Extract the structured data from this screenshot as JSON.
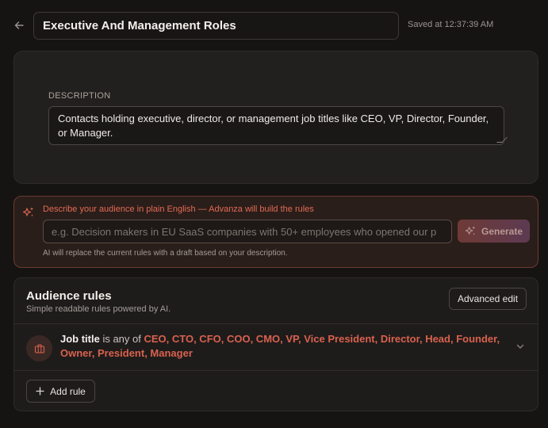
{
  "header": {
    "back_icon": "arrow-left-icon",
    "title": "Executive And Management Roles",
    "saved_status": "Saved at 12:37:39 AM"
  },
  "description": {
    "label": "DESCRIPTION",
    "value": "Contacts holding executive, director, or management job titles like CEO, VP, Director, Founder, or Manager."
  },
  "ai_builder": {
    "icon": "sparkle-icon",
    "title": "Describe your audience in plain English — Advanza will build the rules",
    "placeholder": "e.g. Decision makers in EU SaaS companies with 50+ employees who opened our p",
    "generate_label": "Generate",
    "hint": "AI will replace the current rules with a draft based on your description."
  },
  "rules": {
    "title": "Audience rules",
    "subtitle": "Simple readable rules powered by AI.",
    "advanced_edit_label": "Advanced edit",
    "items": [
      {
        "icon": "briefcase-icon",
        "field": "Job title",
        "operator": " is any of ",
        "values": "CEO, CTO, CFO, COO, CMO, VP, Vice President, Director, Head, Founder, Owner, President, Manager"
      }
    ],
    "add_rule_label": "Add rule"
  },
  "colors": {
    "background": "#161413",
    "accent": "#e26a55",
    "rule_value": "#d9614e"
  }
}
